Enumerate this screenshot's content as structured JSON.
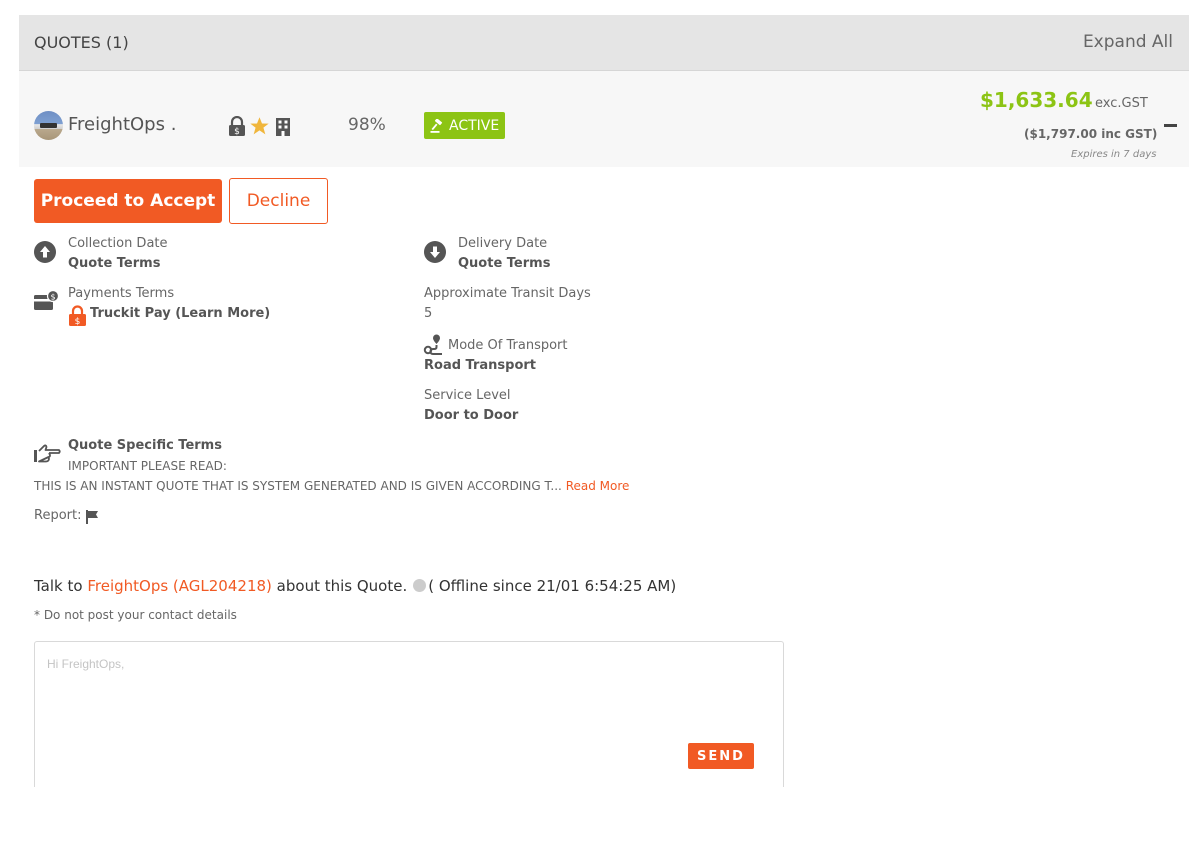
{
  "header": {
    "title": "QUOTES (1)",
    "expand_label": "Expand All"
  },
  "quote": {
    "carrier_name": "FreightOps .",
    "icons": [
      "lock-dollar-icon",
      "star-icon",
      "building-icon"
    ],
    "rating": "98%",
    "status": "ACTIVE",
    "price": "$1,633.64",
    "price_suffix": "exc.GST",
    "price_inc": "($1,797.00 inc GST)",
    "expires": "Expires in 7 days",
    "accept_label": "Proceed to Accept",
    "decline_label": "Decline",
    "colors": {
      "accent": "#f15a24",
      "active": "#8cc414",
      "price": "#8cc414"
    }
  },
  "details": {
    "collection": {
      "label": "Collection Date",
      "value": "Quote Terms"
    },
    "delivery": {
      "label": "Delivery Date",
      "value": "Quote Terms"
    },
    "payments": {
      "label": "Payments Terms",
      "value": "Truckit Pay (Learn More)"
    },
    "transit": {
      "label": "Approximate Transit Days",
      "value": "5"
    },
    "mode": {
      "label": "Mode Of Transport",
      "value": "Road Transport"
    },
    "service": {
      "label": "Service Level",
      "value": "Door to Door"
    },
    "terms": {
      "label": "Quote Specific Terms",
      "line1": "IMPORTANT PLEASE READ:",
      "line2": "THIS IS AN INSTANT QUOTE THAT IS SYSTEM GENERATED AND IS GIVEN ACCORDING T...",
      "read_more": "Read More"
    },
    "report_label": "Report:"
  },
  "chat": {
    "prefix": "Talk to",
    "carrier_link": "FreightOps (AGL204218)",
    "suffix": "about this Quote.",
    "status": "( Offline since 21/01 6:54:25 AM)",
    "note": "* Do not post your contact details",
    "placeholder": "Hi FreightOps,",
    "send_label": "SEND"
  }
}
